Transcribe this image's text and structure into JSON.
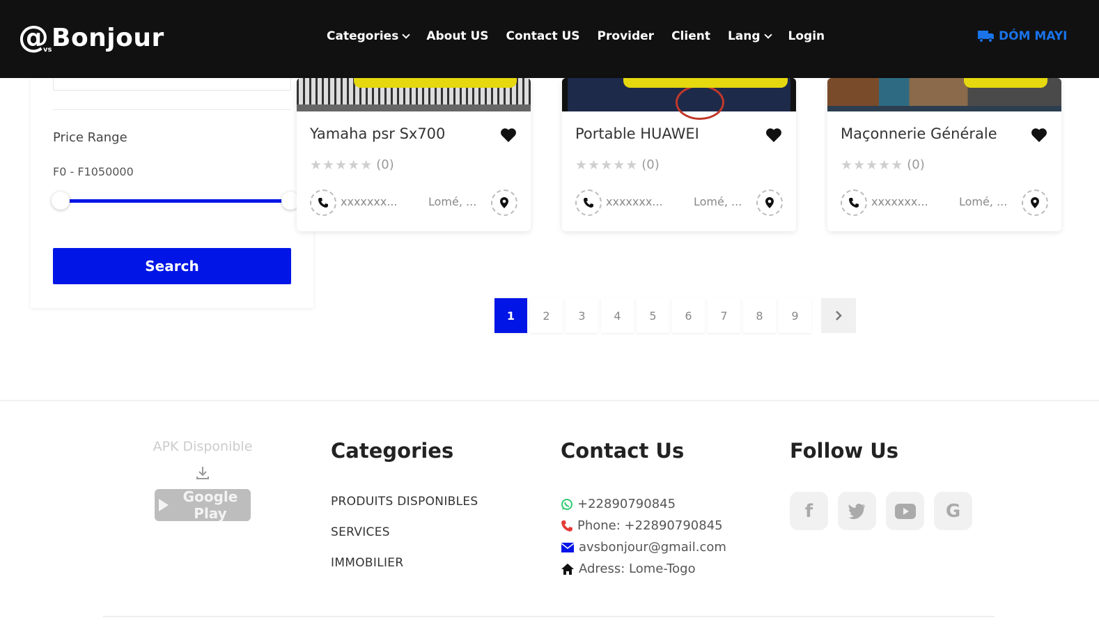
{
  "header": {
    "logo_at": "@",
    "logo_sub": "vs",
    "logo_text": "Bonjour",
    "nav": [
      {
        "label": "Categories",
        "has_dropdown": true
      },
      {
        "label": "About US",
        "has_dropdown": false
      },
      {
        "label": "Contact US",
        "has_dropdown": false
      },
      {
        "label": "Provider",
        "has_dropdown": false
      },
      {
        "label": "Client",
        "has_dropdown": false
      },
      {
        "label": "Lang",
        "has_dropdown": true
      },
      {
        "label": "Login",
        "has_dropdown": false
      }
    ],
    "cta_label": "DÓM MAYI",
    "cta_icon": "truck-icon"
  },
  "sidebar": {
    "price_label": "Price Range",
    "price_value": "F0 - F1050000",
    "search_label": "Search"
  },
  "cards": [
    {
      "title": "Yamaha psr Sx700",
      "rating_count": "(0)",
      "phone": "xxxxxxx...",
      "location": "Lomé, ..."
    },
    {
      "title": "Portable HUAWEI",
      "rating_count": "(0)",
      "phone": "xxxxxxx...",
      "location": "Lomé, ..."
    },
    {
      "title": "Maçonnerie Générale",
      "rating_count": "(0)",
      "phone": "xxxxxxx...",
      "location": "Lomé, ..."
    }
  ],
  "pagination": {
    "pages": [
      "1",
      "2",
      "3",
      "4",
      "5",
      "6",
      "7",
      "8",
      "9"
    ],
    "active": "1"
  },
  "footer": {
    "apk_title": "APK Disponible",
    "gplay_label": "Google Play",
    "categories_title": "Categories",
    "categories": [
      "PRODUITS DISPONIBLES",
      "SERVICES",
      "IMMOBILIER"
    ],
    "contact_title": "Contact Us",
    "contact": {
      "whatsapp": "+22890790845",
      "phone": "Phone: +22890790845",
      "email": "avsbonjour@gmail.com",
      "address": "Adress: Lome-Togo"
    },
    "follow_title": "Follow Us",
    "socials": [
      "facebook-icon",
      "twitter-icon",
      "youtube-icon",
      "google-icon"
    ]
  },
  "colors": {
    "header_bg": "#111111",
    "primary_blue": "#0015e6",
    "cta_blue": "#1a73e8",
    "accent_yellow": "#e5d80f"
  }
}
